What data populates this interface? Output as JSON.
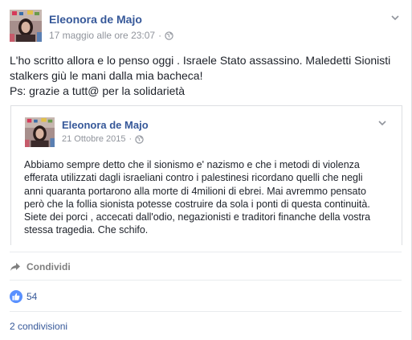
{
  "post": {
    "author": "Eleonora de Majo",
    "timestamp": "17 maggio alle ore 23:07",
    "separator": "·",
    "privacy_icon": "globe-icon",
    "menu_icon": "chevron-down-icon",
    "text_lines": [
      "L'ho scritto allora e lo penso oggi . Israele Stato assassino. Maledetti Sionisti",
      "stalkers giù le mani dalla mia bacheca!",
      "Ps: grazie a tutt@ per la solidarietà"
    ]
  },
  "shared_post": {
    "author": "Eleonora de Majo",
    "date": "21 Ottobre 2015",
    "separator": "·",
    "privacy_icon": "globe-icon",
    "menu_icon": "chevron-down-icon",
    "text_lines": [
      "Abbiamo sempre detto che il sionismo e' nazismo e che i metodi di violenza",
      "efferata utilizzati dagli israeliani contro i palestinesi ricordano quelli che negli",
      "anni quaranta portarono alla morte di 4milioni di ebrei. Mai avremmo pensato",
      "però che la follia sionista potesse costruire da sola i ponti di questa continuità.",
      "Siete dei porci , accecati dall'odio, negazionisti e traditori finanche della vostra",
      "stessa tragedia. Che schifo."
    ]
  },
  "actions": {
    "share_label": "Condividi",
    "share_icon": "share-arrow-icon"
  },
  "reactions": {
    "like_icon": "thumbs-up-icon",
    "like_count": "54"
  },
  "shares": {
    "label": "2 condivisioni"
  },
  "colors": {
    "link_blue": "#365899",
    "meta_gray": "#90949c",
    "like_blue": "#5890ff",
    "border": "#dddfe2"
  }
}
